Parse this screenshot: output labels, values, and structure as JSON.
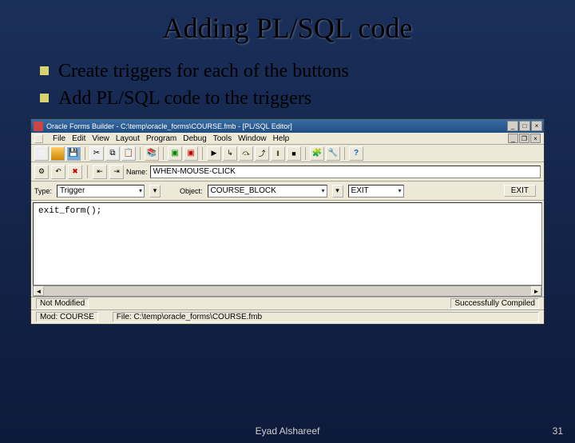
{
  "slide": {
    "title": "Adding PL/SQL code",
    "bullets": [
      "Create triggers  for each of the buttons",
      "Add PL/SQL code to the triggers"
    ],
    "author": "Eyad Alshareef",
    "page_number": "31"
  },
  "window": {
    "title": "Oracle Forms Builder - C:\\temp\\oracle_forms\\COURSE.fmb - [PL/SQL Editor]",
    "menus": [
      "File",
      "Edit",
      "View",
      "Layout",
      "Program",
      "Debug",
      "Tools",
      "Window",
      "Help"
    ],
    "name_label": "Name:",
    "name_value": "WHEN-MOUSE-CLICK",
    "type_label": "Type:",
    "type_value": "Trigger",
    "object_label": "Object:",
    "object_value": "COURSE_BLOCK",
    "exit_button": "EXIT",
    "code": "exit_form();",
    "status_left": "Not Modified",
    "status_right": "Successfully Compiled",
    "mod_label": "Mod: COURSE",
    "file_label": "File: C:\\temp\\oracle_forms\\COURSE.fmb"
  }
}
